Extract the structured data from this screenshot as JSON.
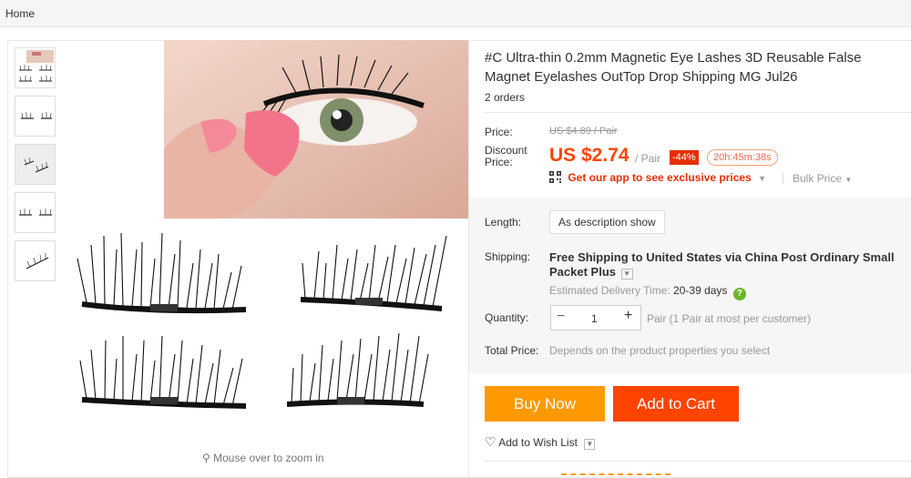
{
  "breadcrumb": {
    "home": "Home"
  },
  "gallery": {
    "zoom_hint": "Mouse over to zoom in"
  },
  "product": {
    "title": "#C Ultra-thin 0.2mm Magnetic Eye Lashes 3D Reusable False Magnet Eyelashes OutTop Drop Shipping MG Jul26",
    "orders": "2 orders"
  },
  "pricing": {
    "price_label": "Price:",
    "old_price": "US $4.89 / Pair",
    "discount_label": "Discount Price:",
    "discount_price": "US $2.74",
    "per_unit": "/ Pair",
    "discount_badge": "-44%",
    "countdown": "20h:45m:38s",
    "app_promo": "Get our app to see exclusive prices",
    "bulk_price": "Bulk Price"
  },
  "options": {
    "length_label": "Length:",
    "length_value": "As description show",
    "shipping_label": "Shipping:",
    "shipping_prefix": "Free Shipping",
    "shipping_to": "to",
    "shipping_dest": "United States via China Post Ordinary Small Packet Plus",
    "estimated_label": "Estimated Delivery Time:",
    "estimated_days": "20-39 days",
    "quantity_label": "Quantity:",
    "quantity_value": "1",
    "quantity_note": "Pair (1 Pair at most per customer)",
    "total_label": "Total Price:",
    "total_value": "Depends on the product properties you select"
  },
  "actions": {
    "buy_now": "Buy Now",
    "add_to_cart": "Add to Cart",
    "wish_list": "Add to Wish List"
  },
  "colors": {
    "price_red": "#ff4400",
    "buy_orange": "#ff9900",
    "cart_orange": "#ff4400",
    "badge_red": "#e62e04"
  }
}
